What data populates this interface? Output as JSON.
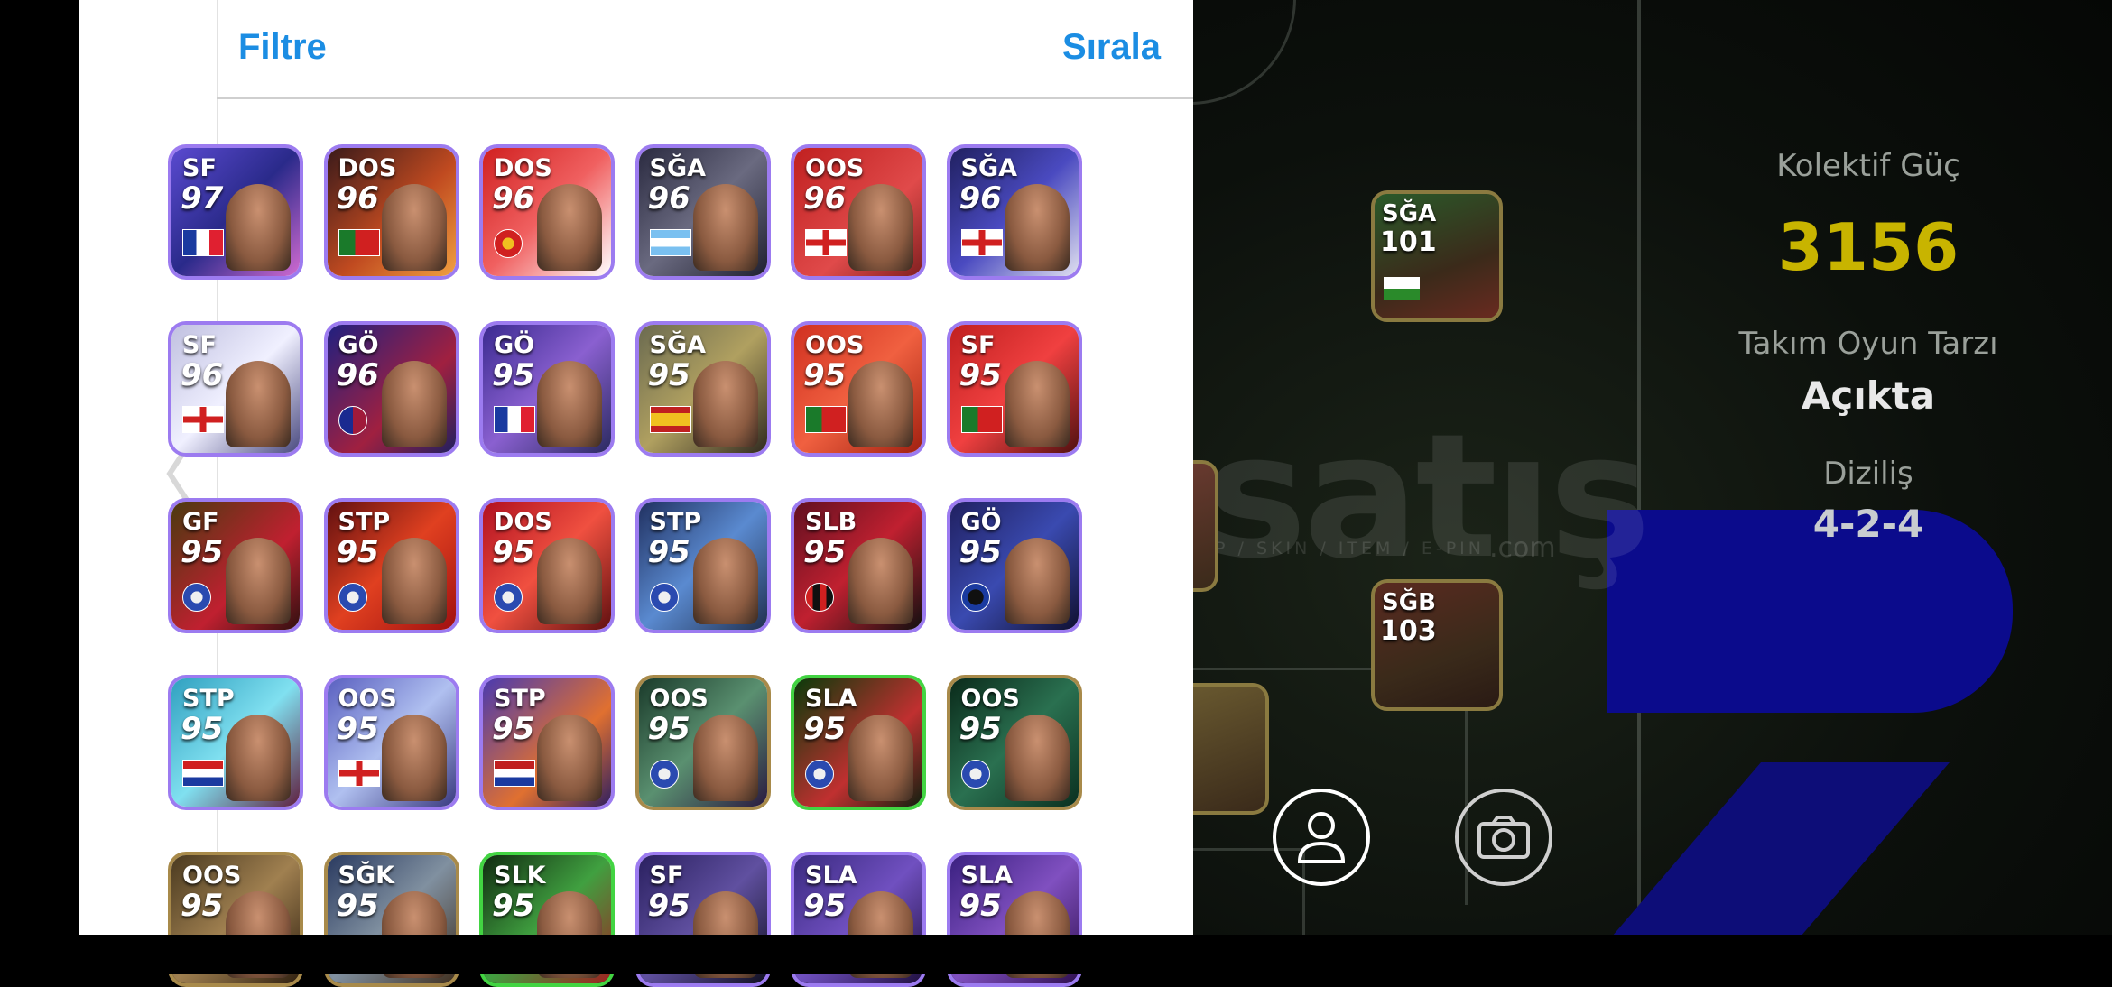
{
  "header": {
    "filter_label": "Filtre",
    "sort_label": "Sırala"
  },
  "stats": {
    "collective_power_label": "Kolektif Güç",
    "collective_power_value": "3156",
    "play_style_label": "Takım Oyun Tarzı",
    "play_style_value": "Açıkta",
    "formation_label": "Diziliş",
    "formation_value": "4-2-4"
  },
  "pitch_cards": [
    {
      "position": "SĞA",
      "rating": "101"
    },
    {
      "position": "SĞB",
      "rating": "103"
    }
  ],
  "watermark": {
    "text": "satış",
    "sub": "EP / SKIN / ITEM / E-PIN",
    "com": ".com"
  },
  "cards": [
    {
      "position": "SF",
      "rating": "97",
      "flag": "france"
    },
    {
      "position": "DOS",
      "rating": "96",
      "flag": "portugal"
    },
    {
      "position": "DOS",
      "rating": "96",
      "flag": "arsenal"
    },
    {
      "position": "SĞA",
      "rating": "96",
      "flag": "argentina"
    },
    {
      "position": "OOS",
      "rating": "96",
      "flag": "england"
    },
    {
      "position": "SĞA",
      "rating": "96",
      "flag": "england"
    },
    {
      "position": "SF",
      "rating": "96",
      "flag": "england"
    },
    {
      "position": "GÖ",
      "rating": "96",
      "flag": "barcelona"
    },
    {
      "position": "GÖ",
      "rating": "95",
      "flag": "france"
    },
    {
      "position": "SĞA",
      "rating": "95",
      "flag": "spain"
    },
    {
      "position": "OOS",
      "rating": "95",
      "flag": "portugal"
    },
    {
      "position": "SF",
      "rating": "95",
      "flag": "portugal"
    },
    {
      "position": "GF",
      "rating": "95",
      "flag": "club"
    },
    {
      "position": "STP",
      "rating": "95",
      "flag": "club"
    },
    {
      "position": "DOS",
      "rating": "95",
      "flag": "club"
    },
    {
      "position": "STP",
      "rating": "95",
      "flag": "club"
    },
    {
      "position": "SLB",
      "rating": "95",
      "flag": "milan"
    },
    {
      "position": "GÖ",
      "rating": "95",
      "flag": "inter"
    },
    {
      "position": "STP",
      "rating": "95",
      "flag": "croatia"
    },
    {
      "position": "OOS",
      "rating": "95",
      "flag": "england"
    },
    {
      "position": "STP",
      "rating": "95",
      "flag": "netherlands"
    },
    {
      "position": "OOS",
      "rating": "95",
      "flag": "club"
    },
    {
      "position": "SLA",
      "rating": "95",
      "flag": "club"
    },
    {
      "position": "OOS",
      "rating": "95",
      "flag": "club"
    },
    {
      "position": "OOS",
      "rating": "95",
      "flag": "club"
    },
    {
      "position": "SĞK",
      "rating": "95",
      "flag": "club"
    },
    {
      "position": "SLK",
      "rating": "95",
      "flag": "club"
    },
    {
      "position": "SF",
      "rating": "95",
      "flag": "club"
    },
    {
      "position": "SLA",
      "rating": "95",
      "flag": "club"
    },
    {
      "position": "SLA",
      "rating": "95",
      "flag": "club"
    }
  ],
  "colors": {
    "accent": "#1b8de3",
    "power": "#c8b400"
  }
}
